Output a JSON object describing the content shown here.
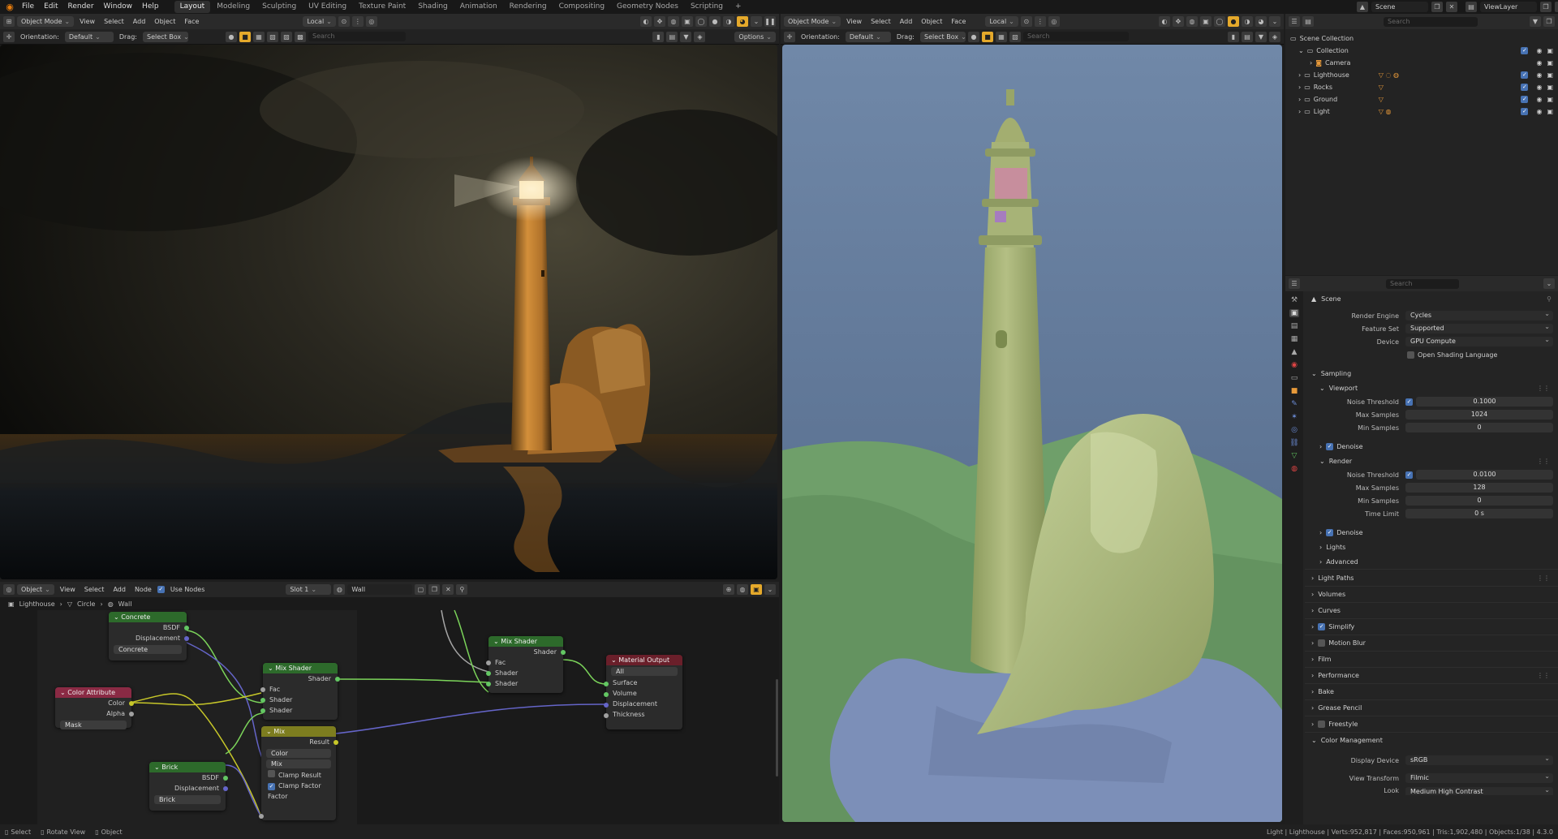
{
  "app": {
    "logo": "blender-logo-icon"
  },
  "menu": [
    "File",
    "Edit",
    "Render",
    "Window",
    "Help"
  ],
  "workspaces": [
    "Layout",
    "Modeling",
    "Sculpting",
    "UV Editing",
    "Texture Paint",
    "Shading",
    "Animation",
    "Rendering",
    "Compositing",
    "Geometry Nodes",
    "Scripting"
  ],
  "active_workspace": "Layout",
  "add_workspace": "+",
  "scene_selector": {
    "label": "Scene"
  },
  "viewlayer_selector": {
    "label": "ViewLayer"
  },
  "left_viewport": {
    "mode": "Object Mode",
    "menus": [
      "View",
      "Select",
      "Add",
      "Object",
      "Face"
    ],
    "transform": "Local",
    "orientation_label": "Orientation:",
    "orientation_value": "Default",
    "drag_label": "Drag:",
    "drag_value": "Select Box",
    "search_placeholder": "Search",
    "options": "Options"
  },
  "right_viewport": {
    "mode": "Object Mode",
    "menus": [
      "View",
      "Select",
      "Add",
      "Object",
      "Face"
    ],
    "transform": "Local",
    "orientation_label": "Orientation:",
    "orientation_value": "Default",
    "drag_label": "Drag:",
    "drag_value": "Select Box",
    "search_placeholder": "Search"
  },
  "node_editor": {
    "type": "Object",
    "menus": [
      "View",
      "Select",
      "Add",
      "Node"
    ],
    "use_nodes": "Use Nodes",
    "slot": "Slot 1",
    "material": "Wall",
    "breadcrumb": [
      "Lighthouse",
      "Circle",
      "Wall"
    ],
    "nodes": {
      "concrete": {
        "title": "Concrete",
        "outputs": [
          "BSDF",
          "Displacement"
        ],
        "field": "Concrete"
      },
      "color_attr": {
        "title": "Color Attribute",
        "outputs": [
          "Color",
          "Alpha"
        ],
        "field": "Mask"
      },
      "mix_shader_1": {
        "title": "Mix Shader",
        "output": "Shader",
        "inputs": [
          "Fac",
          "Shader",
          "Shader"
        ]
      },
      "mix": {
        "title": "Mix",
        "output": "Result",
        "type": "Color",
        "blend": "Mix",
        "clamp_result": "Clamp Result",
        "clamp_factor": "Clamp Factor",
        "input": "Factor"
      },
      "brick": {
        "title": "Brick",
        "outputs": [
          "BSDF",
          "Displacement"
        ],
        "field": "Brick"
      },
      "mix_shader_2": {
        "title": "Mix Shader",
        "output": "Shader",
        "inputs": [
          "Fac",
          "Shader",
          "Shader"
        ]
      },
      "material_output": {
        "title": "Material Output",
        "target": "All",
        "inputs": [
          "Surface",
          "Volume",
          "Displacement",
          "Thickness"
        ]
      }
    }
  },
  "outliner": {
    "search_placeholder": "Search",
    "items": [
      {
        "label": "Scene Collection",
        "level": 0
      },
      {
        "label": "Collection",
        "level": 1
      },
      {
        "label": "Camera",
        "level": 2
      },
      {
        "label": "Lighthouse",
        "level": 1
      },
      {
        "label": "Rocks",
        "level": 1
      },
      {
        "label": "Ground",
        "level": 1
      },
      {
        "label": "Light",
        "level": 1
      }
    ]
  },
  "properties": {
    "search_placeholder": "Search",
    "context": "Scene",
    "render_engine_label": "Render Engine",
    "render_engine": "Cycles",
    "feature_set_label": "Feature Set",
    "feature_set": "Supported",
    "device_label": "Device",
    "device": "GPU Compute",
    "osl": "Open Shading Language",
    "sampling": "Sampling",
    "viewport": "Viewport",
    "noise_threshold_label": "Noise Threshold",
    "vp_noise_threshold": "0.1000",
    "max_samples_label": "Max Samples",
    "vp_max_samples": "1024",
    "min_samples_label": "Min Samples",
    "vp_min_samples": "0",
    "denoise": "Denoise",
    "render": "Render",
    "r_noise_threshold": "0.0100",
    "r_max_samples": "128",
    "r_min_samples": "0",
    "time_limit_label": "Time Limit",
    "r_time_limit": "0 s",
    "lights": "Lights",
    "advanced": "Advanced",
    "light_paths": "Light Paths",
    "volumes": "Volumes",
    "curves": "Curves",
    "simplify": "Simplify",
    "motion_blur": "Motion Blur",
    "film": "Film",
    "performance": "Performance",
    "bake": "Bake",
    "grease_pencil": "Grease Pencil",
    "freestyle": "Freestyle",
    "color_management": "Color Management",
    "display_device_label": "Display Device",
    "display_device": "sRGB",
    "view_transform_label": "View Transform",
    "view_transform": "Filmic",
    "look_label": "Look",
    "look": "Medium High Contrast"
  },
  "status": {
    "select": "Select",
    "rotate": "Rotate View",
    "object": "Object",
    "stats": "Light | Lighthouse | Verts:952,817 | Faces:950,961 | Tris:1,902,480 | Objects:1/38 | 4.3.0"
  },
  "colors": {
    "accent": "#e5a92b",
    "select_blue": "#4772b3",
    "shader_header": "#2d6a2b",
    "input_header": "#8a2a44",
    "output_header": "#6a1f2a",
    "converter_header": "#7d7d1f"
  }
}
